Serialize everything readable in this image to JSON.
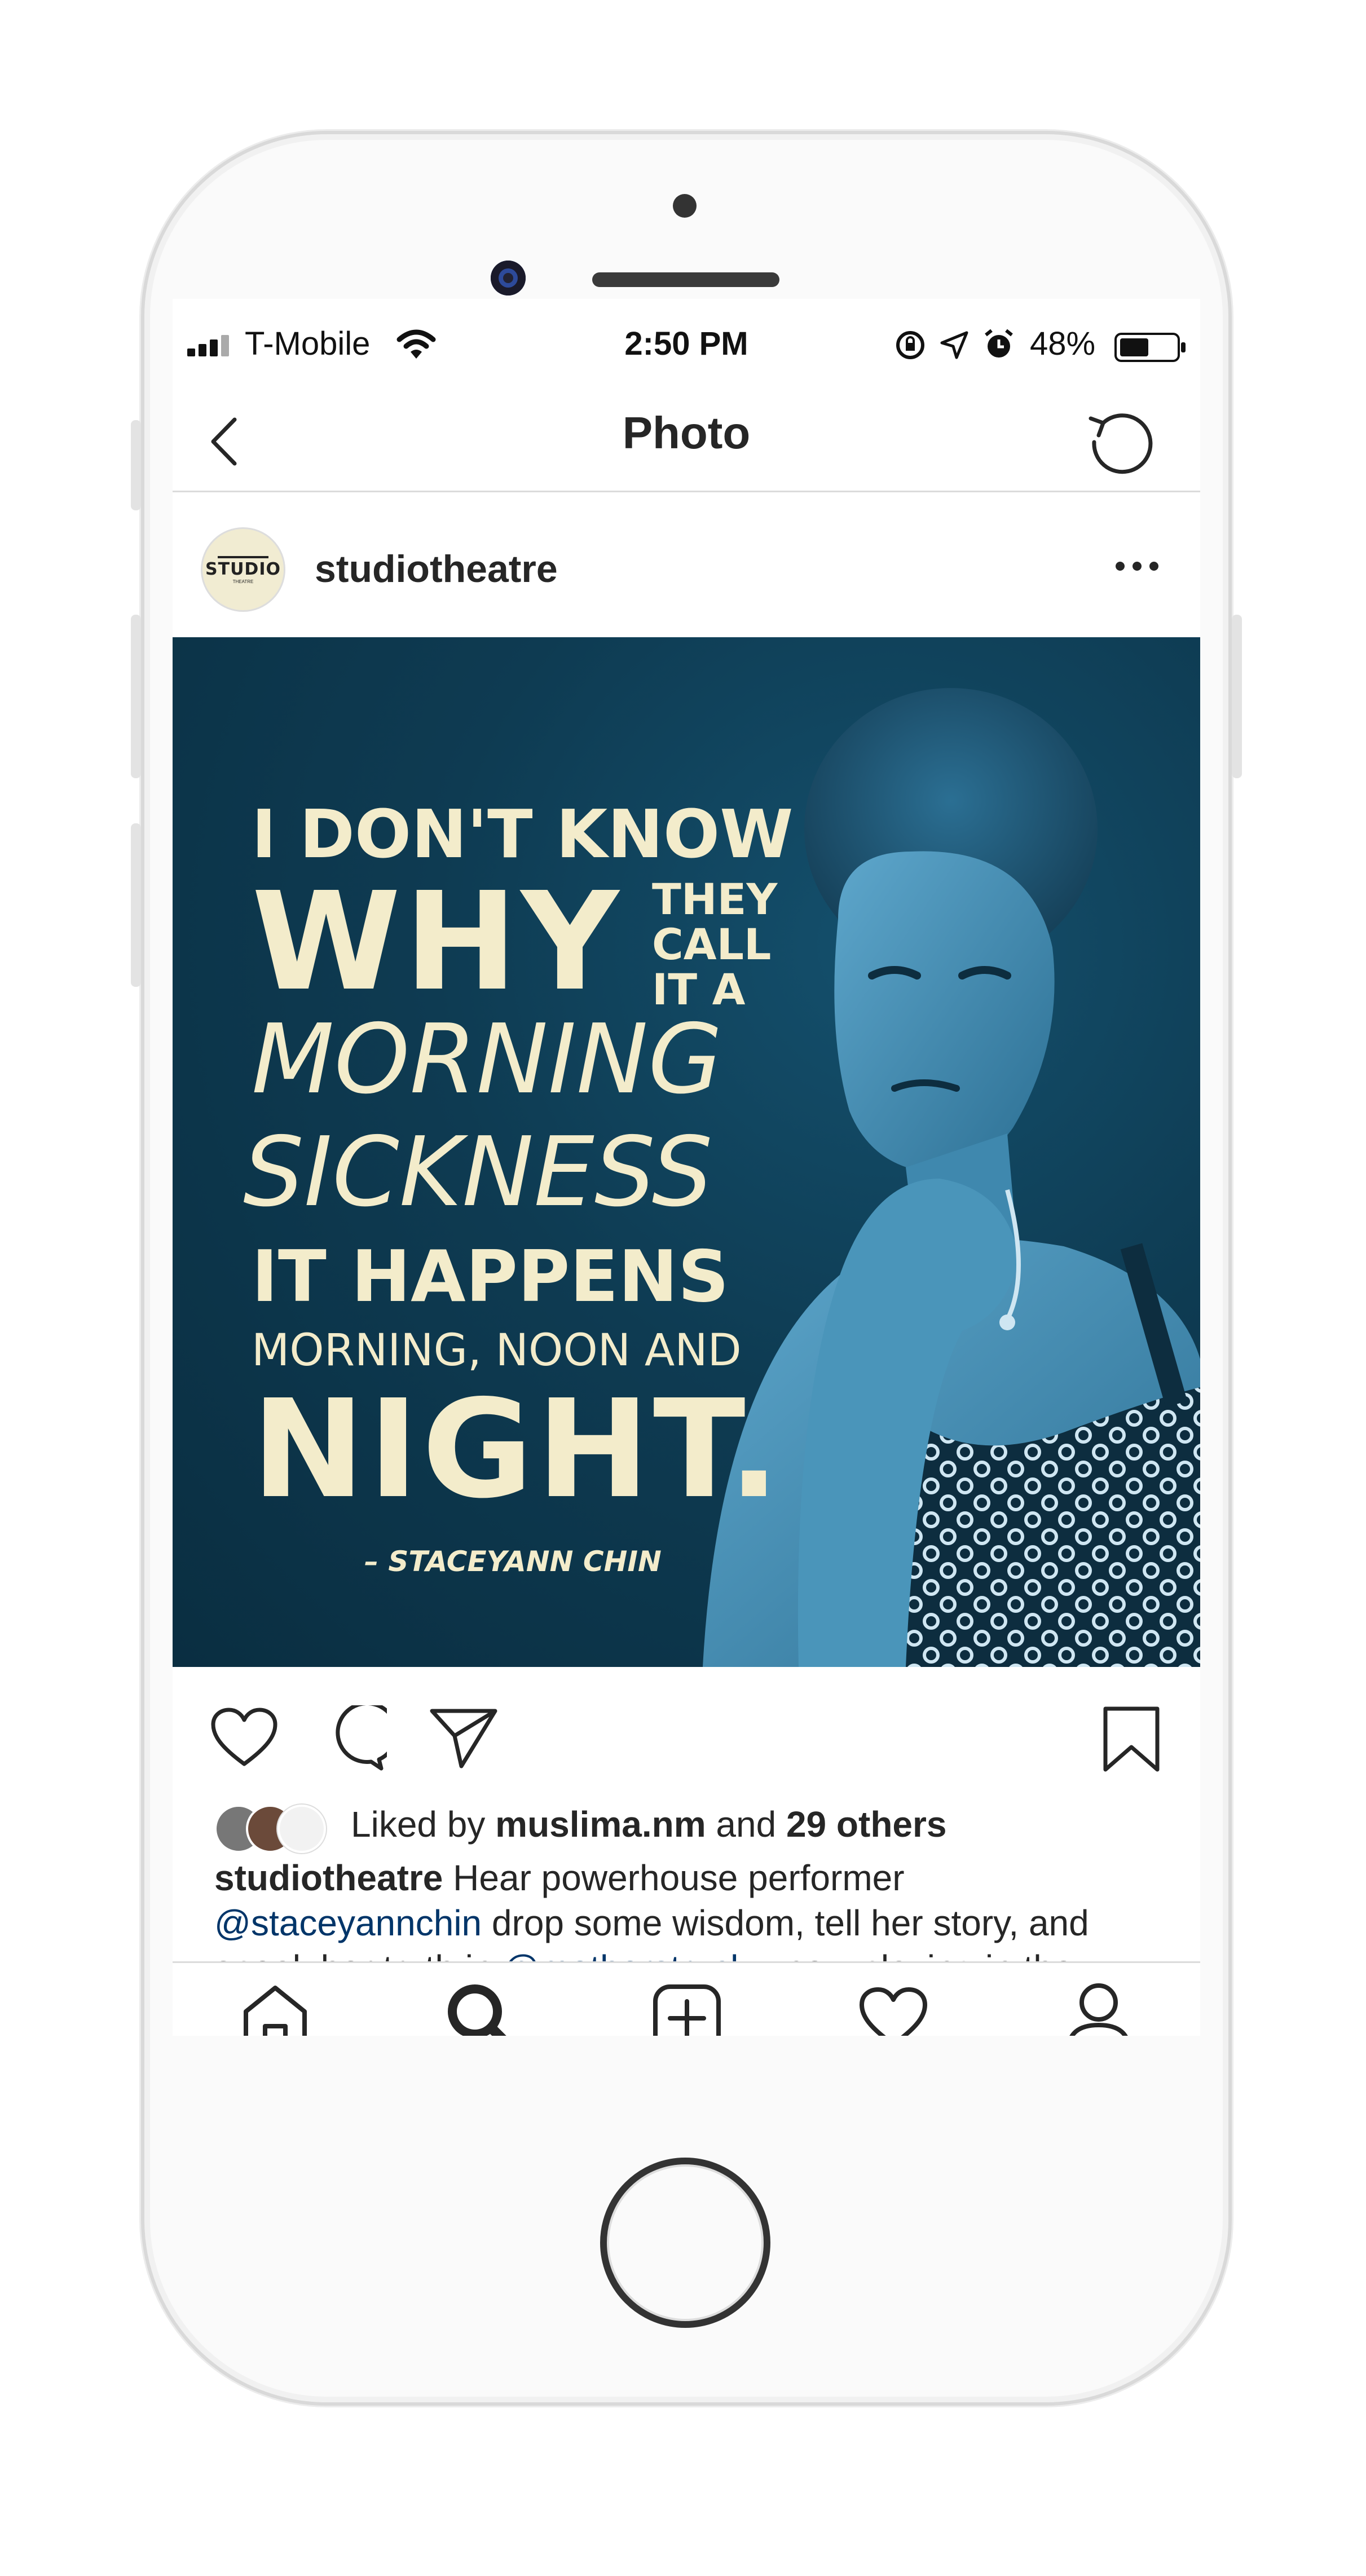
{
  "status_bar": {
    "carrier": "T-Mobile",
    "time": "2:50 PM",
    "battery": "48%"
  },
  "header": {
    "title": "Photo"
  },
  "post": {
    "username": "studiotheatre",
    "avatar_text": "STUDIO",
    "avatar_subtext": "THEATRE",
    "image_quote": {
      "line1": "I DON'T KNOW",
      "line2_big": "WHY",
      "line2_small_a": "THEY",
      "line2_small_b": "CALL",
      "line2_small_c": "IT A",
      "line3": "MORNING",
      "line4": "SICKNESS",
      "line5": "IT HAPPENS",
      "line6": "MORNING, NOON AND",
      "line7": "NIGHT.",
      "attribution": "– STACEYANN CHIN"
    },
    "likes": {
      "prefix": "Liked by",
      "user": "muslima.nm",
      "conjunction": "and",
      "others": "29 others"
    },
    "caption": {
      "author": "studiotheatre",
      "text1": "Hear powerhouse performer",
      "mention1": "@staceyannchin",
      "text2": "drop some wisdom, tell her story, and speak her truth in",
      "mention2": "@motherstruck",
      "text3": "—now playing in the Milton!"
    }
  },
  "icons": {
    "back": "chevron-left-icon",
    "refresh": "refresh-icon",
    "more": "more-horizontal-icon",
    "like": "heart-icon",
    "comment": "comment-icon",
    "share": "send-icon",
    "save": "bookmark-icon",
    "home": "home-icon",
    "search": "search-icon",
    "new_post": "plus-square-icon",
    "activity": "heart-icon",
    "profile": "profile-icon"
  },
  "colors": {
    "mention": "#003569",
    "quote_text": "#f3eccb",
    "photo_bg": "#0e3b52"
  }
}
